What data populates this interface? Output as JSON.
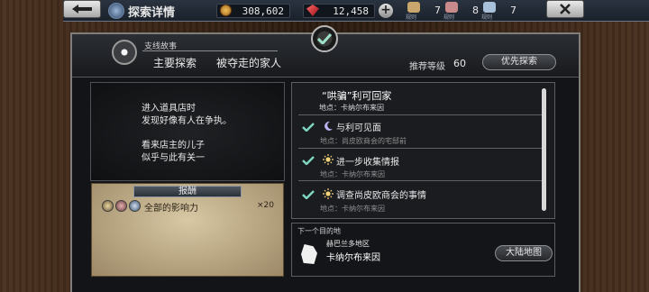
{
  "header": {
    "title": "探索详情",
    "coins": "308,602",
    "gems": "12,458",
    "tickets": [
      {
        "label": "规则",
        "count": "7",
        "color": "#c9a66b"
      },
      {
        "label": "规则",
        "count": "8",
        "color": "#c88a8a"
      },
      {
        "label": "规则",
        "count": "7",
        "color": "#a9c0da"
      }
    ]
  },
  "quest": {
    "sub_kind": "支线故事",
    "main_kind": "主要探索",
    "name": "被夺走的家人",
    "level_label": "推荐等级",
    "level_value": "60",
    "priority_label": "优先探索"
  },
  "story": {
    "lines": [
      "进入道具店时",
      "发现好像有人在争执。",
      "看来店主的儿子",
      "似乎与此有关一"
    ]
  },
  "reward": {
    "banner": "报酬",
    "text": "全部的影响力",
    "count": "×20"
  },
  "steps": {
    "title": "“哄骗”利可回家",
    "location": "地点：卡纳尔布来因",
    "items": [
      {
        "title": "与利可见面",
        "location": "地点：尚皮欧商会的宅邸前"
      },
      {
        "title": "进一步收集情报",
        "location": "地点：卡纳尔布来因"
      },
      {
        "title": "调查尚皮欧商会的事情",
        "location": "地点：卡纳尔布来因"
      }
    ]
  },
  "destination": {
    "label": "下一个目的地",
    "region": "赫巴兰多地区",
    "place": "卡纳尔布来因",
    "map_button": "大陆地图"
  }
}
